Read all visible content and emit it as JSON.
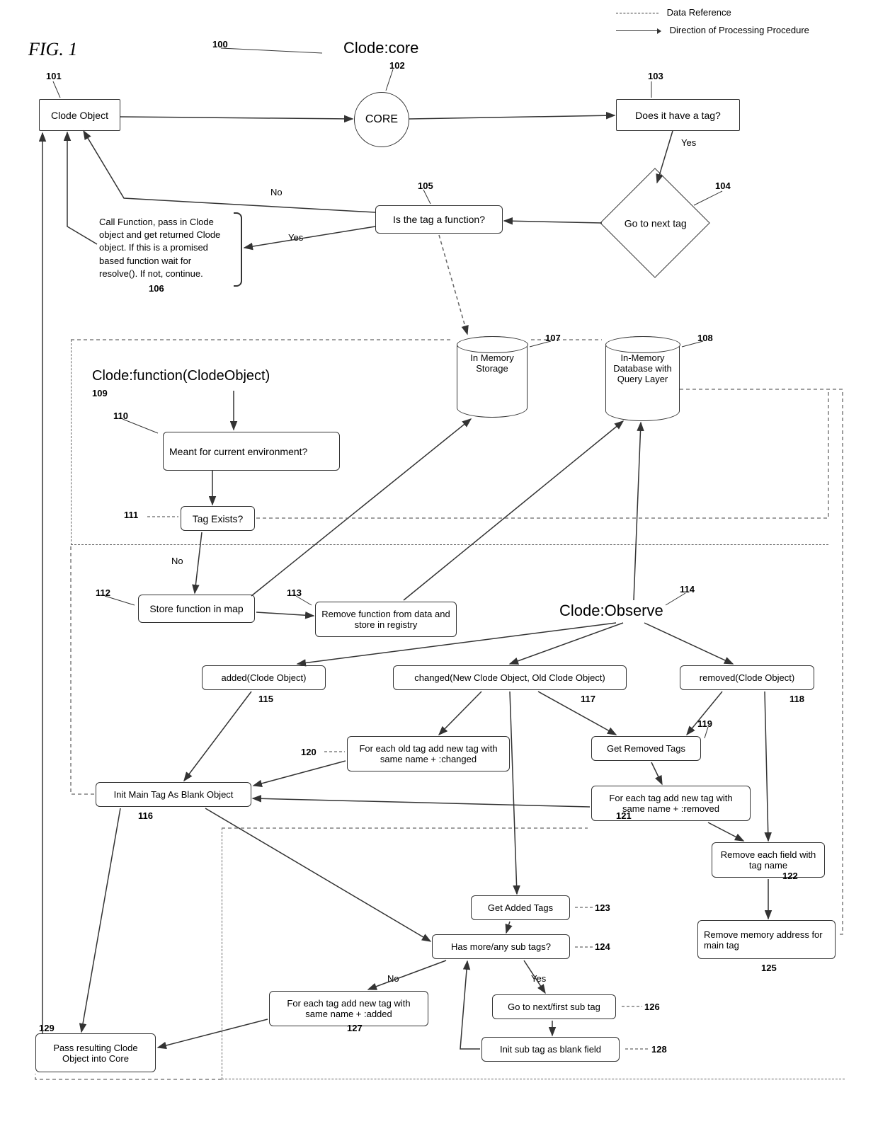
{
  "figure": "FIG. 1",
  "legend": {
    "data_ref": "Data Reference",
    "proc_dir": "Direction of Processing Procedure"
  },
  "titles": {
    "core": "Clode:core",
    "function": "Clode:function(ClodeObject)",
    "observe": "Clode:Observe"
  },
  "refs": {
    "r100": "100",
    "r101": "101",
    "r102": "102",
    "r103": "103",
    "r104": "104",
    "r105": "105",
    "r106": "106",
    "r107": "107",
    "r108": "108",
    "r109": "109",
    "r110": "110",
    "r111": "111",
    "r112": "112",
    "r113": "113",
    "r114": "114",
    "r115": "115",
    "r116": "116",
    "r117": "117",
    "r118": "118",
    "r119": "119",
    "r120": "120",
    "r121": "121",
    "r122": "122",
    "r123": "123",
    "r124": "124",
    "r125": "125",
    "r126": "126",
    "r127": "127",
    "r128": "128",
    "r129": "129"
  },
  "nodes": {
    "clode_object": "Clode Object",
    "core": "CORE",
    "has_tag": "Does it have a tag?",
    "next_tag": "Go to next tag",
    "is_function": "Is the tag a function?",
    "callout_106": "Call Function, pass in Clode object and get returned Clode object. If this is a promised based function wait for resolve(). If not, continue.",
    "mem_storage": "In Memory Storage",
    "mem_db": "In-Memory Database with Query Layer",
    "meant_env": "Meant for current environment?",
    "tag_exists": "Tag Exists?",
    "store_map": "Store function in map",
    "remove_func": "Remove function from data and store in registry",
    "added": "added(Clode Object)",
    "init_main": "Init Main Tag As Blank Object",
    "changed": "changed(New Clode Object, Old Clode Object)",
    "removed": "removed(Clode Object)",
    "get_removed": "Get Removed Tags",
    "each_old": "For each old tag add new tag with same name + :changed",
    "each_removed": "For each tag add new tag with same name + :removed",
    "remove_field": "Remove each field with tag name",
    "get_added": "Get Added Tags",
    "has_sub": "Has more/any sub tags?",
    "remove_addr": "Remove memory address for main tag",
    "go_next_sub": "Go to next/first sub tag",
    "each_added": "For each tag add new tag with same name + :added",
    "init_sub": "Init sub tag as blank field",
    "pass_result": "Pass resulting Clode Object into Core"
  },
  "edges": {
    "yes": "Yes",
    "no": "No"
  }
}
